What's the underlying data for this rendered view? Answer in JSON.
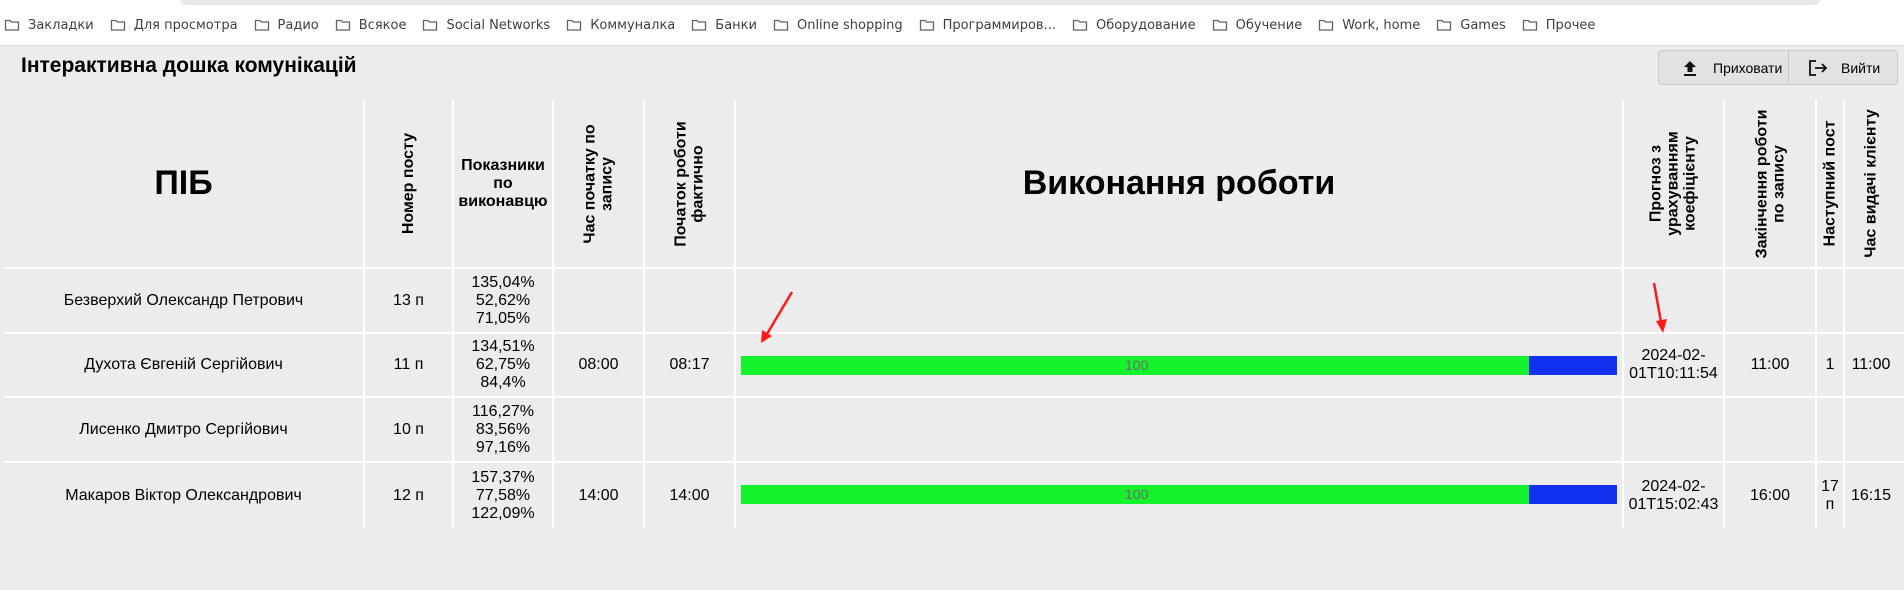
{
  "bookmarks": [
    {
      "label": "Закладки"
    },
    {
      "label": "Для просмотра"
    },
    {
      "label": "Радио"
    },
    {
      "label": "Всякое"
    },
    {
      "label": "Social Networks"
    },
    {
      "label": "Коммуналка"
    },
    {
      "label": "Банки"
    },
    {
      "label": "Online shopping"
    },
    {
      "label": "Программиров..."
    },
    {
      "label": "Оборудование"
    },
    {
      "label": "Обучение"
    },
    {
      "label": "Work, home"
    },
    {
      "label": "Games"
    },
    {
      "label": "Прочее"
    }
  ],
  "page": {
    "title": "Інтерактивна дошка комунікацій",
    "hide_label": "Приховати",
    "exit_label": "Вийти"
  },
  "columns": {
    "name": "ПІБ",
    "post": "Номер посту",
    "kpi_1": "Показники",
    "kpi_2": "по",
    "kpi_3": "виконавцю",
    "planned_1": "Час початку по",
    "planned_2": "запису",
    "actual_1": "Початок роботи",
    "actual_2": "фактично",
    "work": "Виконання роботи",
    "forecast_1": "Прогноз з",
    "forecast_2": "урахуванням",
    "forecast_3": "коефіцієнту",
    "end_1": "Закінчення роботи",
    "end_2": "по запису",
    "next_post": "Наступний пост",
    "issue_time": "Час видачі клієнту"
  },
  "rows": [
    {
      "name": "Безверхий Олександр Петрович",
      "post": "13 п",
      "kpi": [
        "135,04%",
        "52,62%",
        "71,05%"
      ],
      "planned_start": "",
      "actual_start": "",
      "progress": null,
      "progress_label": "",
      "forecast_1": "",
      "forecast_2": "",
      "end": "",
      "next_post_1": "",
      "next_post_2": "",
      "issue": ""
    },
    {
      "name": "Духота Євгеній Сергійович",
      "post": "11 п",
      "kpi": [
        "134,51%",
        "62,75%",
        "84,4%"
      ],
      "planned_start": "08:00",
      "actual_start": "08:17",
      "progress": 0.9,
      "progress_label": "100",
      "forecast_1": "2024-02-",
      "forecast_2": "01T10:11:54",
      "end": "11:00",
      "next_post_1": "1",
      "next_post_2": "",
      "issue": "11:00"
    },
    {
      "name": "Лисенко Дмитро Сергійович",
      "post": "10 п",
      "kpi": [
        "116,27%",
        "83,56%",
        "97,16%"
      ],
      "planned_start": "",
      "actual_start": "",
      "progress": null,
      "progress_label": "",
      "forecast_1": "",
      "forecast_2": "",
      "end": "",
      "next_post_1": "",
      "next_post_2": "",
      "issue": ""
    },
    {
      "name": "Макаров Віктор Олександрович",
      "post": "12 п",
      "kpi": [
        "157,37%",
        "77,58%",
        "122,09%"
      ],
      "planned_start": "14:00",
      "actual_start": "14:00",
      "progress": 0.9,
      "progress_label": "100",
      "forecast_1": "2024-02-",
      "forecast_2": "01T15:02:43",
      "end": "16:00",
      "next_post_1": "17",
      "next_post_2": "п",
      "issue": "16:15"
    }
  ],
  "colors": {
    "bar_done": "#14f22b",
    "bar_rest": "#1230f0",
    "arrow": "#ff1a1a"
  }
}
